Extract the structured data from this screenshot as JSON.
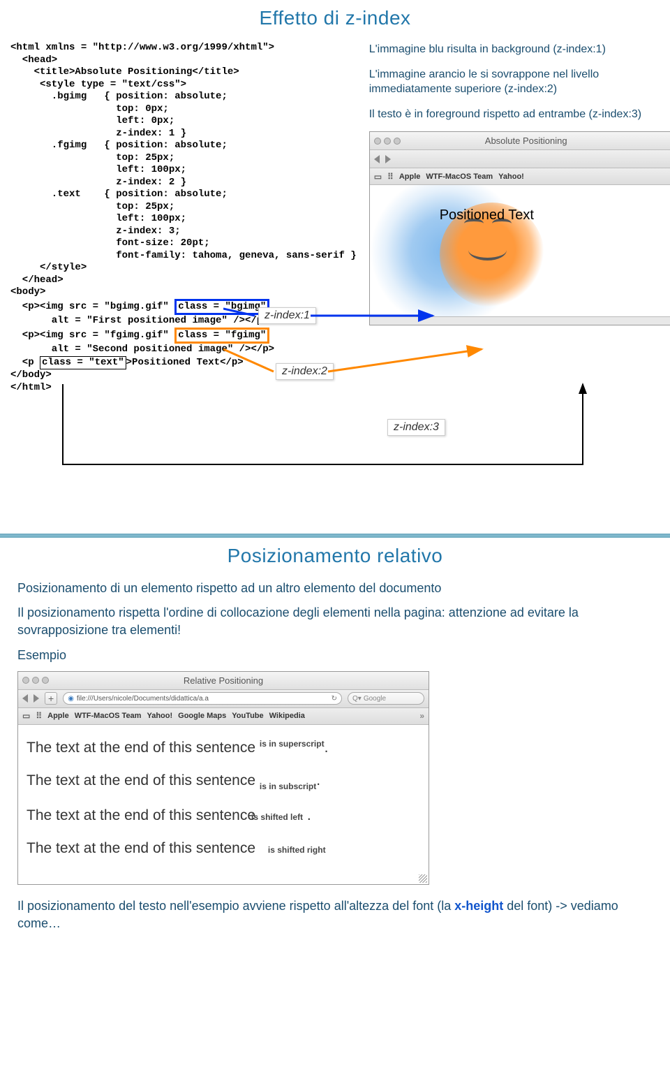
{
  "slide1": {
    "title": "Effetto di z-index",
    "desc1": "L'immagine blu risulta in background (z-index:1)",
    "desc2": "L'immagine arancio le si sovrappone nel livello immediatamente superiore (z-index:2)",
    "desc3": "Il testo è in foreground rispetto ad entrambe (z-index:3)",
    "zlabel1": "z-index:1",
    "zlabel2": "z-index:2",
    "zlabel3": "z-index:3",
    "code": [
      "<html xmlns = \"http://www.w3.org/1999/xhtml\">",
      "  <head>",
      "    <title>Absolute Positioning</title>",
      "     <style type = \"text/css\">",
      "       .bgimg   { position: absolute;",
      "                  top: 0px;",
      "                  left: 0px;",
      "                  z-index: 1 }",
      "       .fgimg   { position: absolute;",
      "                  top: 25px;",
      "                  left: 100px;",
      "                  z-index: 2 }",
      "       .text    { position: absolute;",
      "                  top: 25px;",
      "                  left: 100px;",
      "                  z-index: 3;",
      "                  font-size: 20pt;",
      "                  font-family: tahoma, geneva, sans-serif }",
      "     </style>",
      "  </head>",
      "<body>",
      "  <p><img src = \"bgimg.gif\" ",
      "       alt = \"First positioned image\" /></p>",
      "",
      "  <p><img src = \"fgimg.gif\" ",
      "       alt = \"Second positioned image\" /></p>",
      "",
      "  <p ",
      "</body>",
      "</html>"
    ],
    "hl1": "class = \"bgimg\"",
    "hl2": "class = \"fgimg\"",
    "hl3": "class = \"text\"",
    "postext_tail": ">Positioned Text</p>",
    "browser": {
      "title": "Absolute Positioning",
      "bookmarks": [
        "Apple",
        "WTF-MacOS Team",
        "Yahoo!"
      ],
      "overlay_text": "Positioned Text"
    }
  },
  "slide2": {
    "title": "Posizionamento relativo",
    "line1": "Posizionamento di un elemento rispetto ad un altro elemento del documento",
    "line2": "Il posizionamento rispetta l'ordine di collocazione degli elementi nella pagina: attenzione ad evitare la sovrapposizione tra elementi!",
    "esempio": "Esempio",
    "browser": {
      "title": "Relative Positioning",
      "url": "file:///Users/nicole/Documents/didattica/a.a",
      "search_ph": "Google",
      "bookmarks": [
        "Apple",
        "WTF-MacOS Team",
        "Yahoo!",
        "Google Maps",
        "YouTube",
        "Wikipedia"
      ]
    },
    "sents": {
      "base": "The text at the end of this sentence",
      "sup": "is in superscript",
      "sub": "is in subscript",
      "sl": "is shifted left",
      "sr": "is shifted right",
      "dot": "."
    },
    "footer_a": "Il posizionamento del testo nell'esempio avviene rispetto all'altezza del font (la ",
    "footer_b": "x-height",
    "footer_c": " del font)  -> vediamo come…"
  }
}
